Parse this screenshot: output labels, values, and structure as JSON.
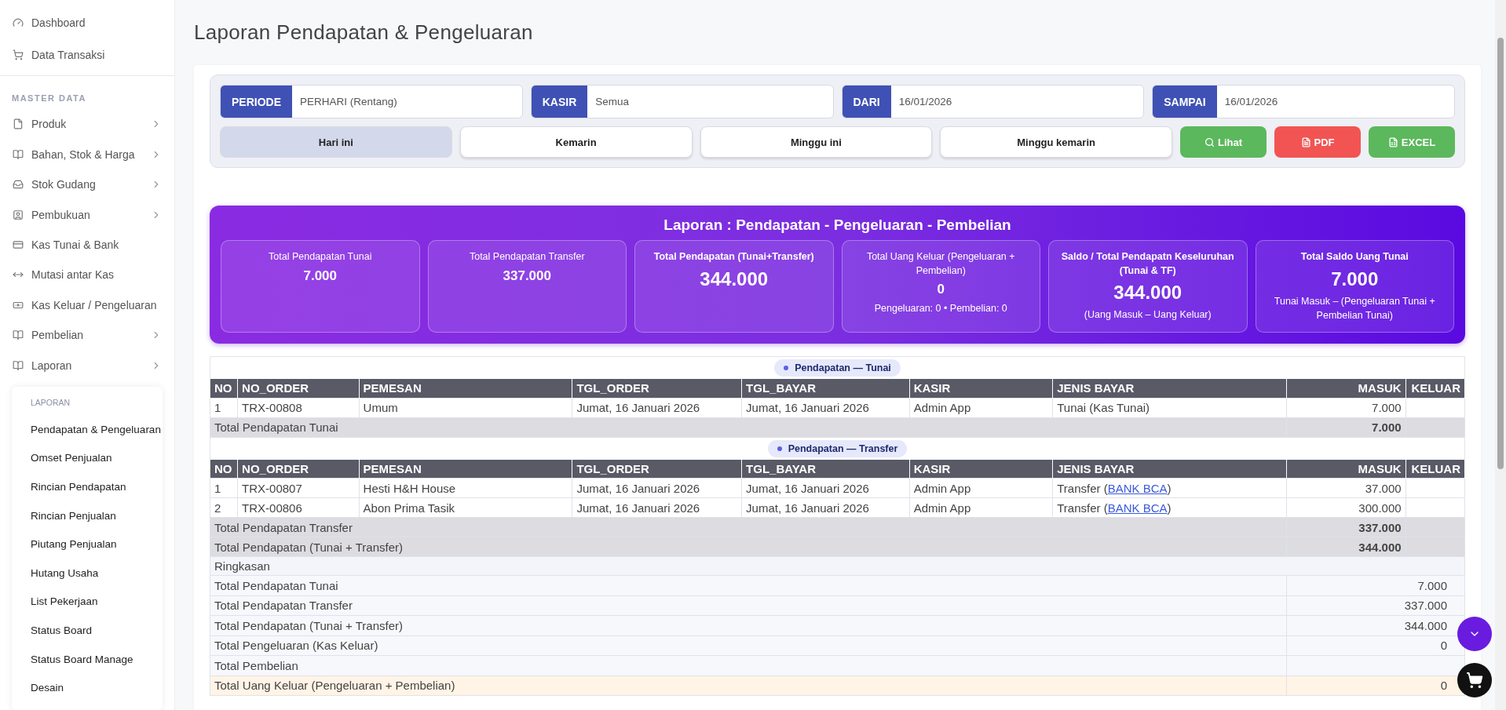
{
  "sidebar": {
    "top_items": [
      {
        "label": "Dashboard"
      },
      {
        "label": "Data Transaksi"
      }
    ],
    "section_title": "MASTER DATA",
    "items": [
      {
        "label": "Produk",
        "has_submenu": true
      },
      {
        "label": "Bahan, Stok & Harga",
        "has_submenu": true
      },
      {
        "label": "Stok Gudang",
        "has_submenu": true
      },
      {
        "label": "Pembukuan",
        "has_submenu": true
      },
      {
        "label": "Kas Tunai & Bank",
        "has_submenu": false
      },
      {
        "label": "Mutasi antar Kas",
        "has_submenu": false
      },
      {
        "label": "Kas Keluar / Pengeluaran",
        "has_submenu": false
      },
      {
        "label": "Pembelian",
        "has_submenu": true
      },
      {
        "label": "Laporan",
        "has_submenu": true
      }
    ],
    "submenu": {
      "title": "LAPORAN",
      "items": [
        "Pendapatan & Pengeluaran",
        "Omset Penjualan",
        "Rincian Pendapatan",
        "Rincian Penjualan",
        "Piutang Penjualan",
        "Hutang Usaha",
        "List Pekerjaan",
        "Status Board",
        "Status Board Manage",
        "Desain"
      ]
    }
  },
  "page_title": "Laporan Pendapatan & Pengeluaran",
  "filters": [
    {
      "label": "PERIODE",
      "value": "PERHARI (Rentang)"
    },
    {
      "label": "KASIR",
      "value": "Semua"
    },
    {
      "label": "DARI",
      "value": "16/01/2026"
    },
    {
      "label": "SAMPAI",
      "value": "16/01/2026"
    }
  ],
  "quick_ranges": [
    {
      "label": "Hari ini",
      "selected": true
    },
    {
      "label": "Kemarin",
      "selected": false
    },
    {
      "label": "Minggu ini",
      "selected": false
    },
    {
      "label": "Minggu kemarin",
      "selected": false
    }
  ],
  "actions": [
    {
      "kind": "view",
      "label": "Lihat"
    },
    {
      "kind": "pdf",
      "label": "PDF"
    },
    {
      "kind": "excel",
      "label": "EXCEL"
    }
  ],
  "banner": {
    "title": "Laporan : Pendapatan - Pengeluaran - Pembelian",
    "cards": [
      {
        "label": "Total Pendapatan Tunai",
        "value": "7.000",
        "emphasis": false
      },
      {
        "label": "Total Pendapatan Transfer",
        "value": "337.000",
        "emphasis": false
      },
      {
        "label": "Total Pendapatan (Tunai+Transfer)",
        "value": "344.000",
        "emphasis": true
      },
      {
        "label": "Total Uang Keluar (Pengeluaran + Pembelian)",
        "value": "0",
        "note": "Pengeluaran: 0 • Pembelian: 0",
        "emphasis": false
      },
      {
        "label": "Saldo / Total Pendapatn Keseluruhan (Tunai & TF)",
        "value": "344.000",
        "note": "(Uang Masuk – Uang Keluar)",
        "emphasis": true
      },
      {
        "label": "Total Saldo Uang Tunai",
        "value": "7.000",
        "note": "Tunai Masuk – (Pengeluaran Tunai + Pembelian Tunai)",
        "emphasis": true
      }
    ]
  },
  "table": {
    "sections": [
      {
        "title": "Pendapatan — Tunai",
        "columns": [
          "NO",
          "NO_ORDER",
          "PEMESAN",
          "TGL_ORDER",
          "TGL_BAYAR",
          "KASIR",
          "JENIS BAYAR",
          "MASUK",
          "KELUAR"
        ],
        "rows": [
          {
            "no": "1",
            "order": "TRX-00808",
            "customer": "Umum",
            "order_date": "Jumat, 16 Januari 2026",
            "pay_date": "Jumat, 16 Januari 2026",
            "cashier": "Admin App",
            "payment": {
              "prefix": "Tunai (Kas Tunai)"
            },
            "in": "7.000"
          }
        ],
        "total": {
          "label": "Total Pendapatan Tunai",
          "in": "7.000"
        }
      },
      {
        "title": "Pendapatan — Transfer",
        "columns": [
          "NO",
          "NO_ORDER",
          "PEMESAN",
          "TGL_ORDER",
          "TGL_BAYAR",
          "KASIR",
          "JENIS BAYAR",
          "MASUK",
          "KELUAR"
        ],
        "rows": [
          {
            "no": "1",
            "order": "TRX-00807",
            "customer": "Hesti H&H House",
            "order_date": "Jumat, 16 Januari 2026",
            "pay_date": "Jumat, 16 Januari 2026",
            "cashier": "Admin App",
            "payment": {
              "prefix": "Transfer (",
              "link": "BANK BCA",
              "suffix": ")"
            },
            "in": "37.000"
          },
          {
            "no": "2",
            "order": "TRX-00806",
            "customer": "Abon Prima Tasik",
            "order_date": "Jumat, 16 Januari 2026",
            "pay_date": "Jumat, 16 Januari 2026",
            "cashier": "Admin App",
            "payment": {
              "prefix": "Transfer (",
              "link": "BANK BCA",
              "suffix": ")"
            },
            "in": "300.000"
          }
        ],
        "total": {
          "label": "Total Pendapatan Transfer",
          "in": "337.000"
        }
      }
    ],
    "grand_total": {
      "label": "Total Pendapatan (Tunai + Transfer)",
      "in": "344.000"
    },
    "summary": {
      "title": "Ringkasan",
      "rows": [
        {
          "label": "Total Pendapatan Tunai",
          "value": "7.000",
          "highlight": false
        },
        {
          "label": "Total Pendapatan Transfer",
          "value": "337.000",
          "highlight": false
        },
        {
          "label": "Total Pendapatan (Tunai + Transfer)",
          "value": "344.000",
          "highlight": false
        },
        {
          "label": "Total Pengeluaran (Kas Keluar)",
          "value": "0",
          "highlight": false
        },
        {
          "label": "Total Pembelian",
          "highlight": false
        },
        {
          "label": "Total Uang Keluar (Pengeluaran + Pembelian)",
          "value": "0",
          "highlight": true
        }
      ]
    }
  }
}
